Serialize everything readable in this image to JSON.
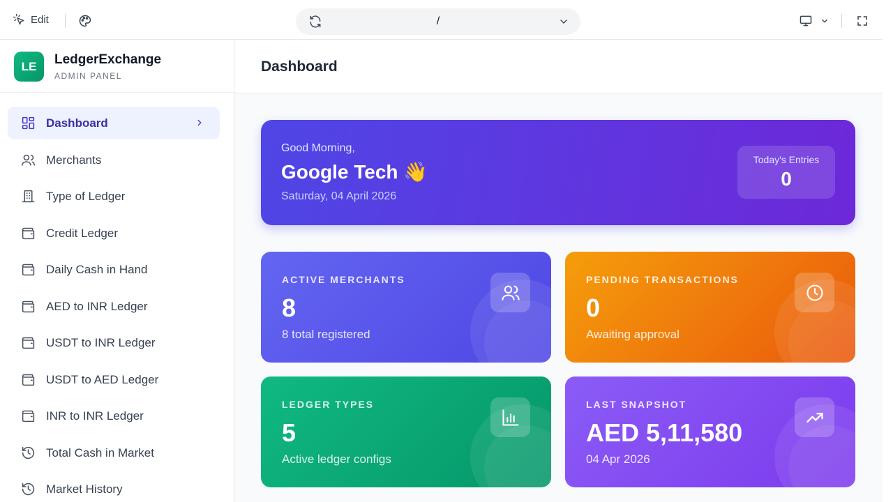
{
  "topbar": {
    "edit_label": "Edit",
    "url_path": "/"
  },
  "brand": {
    "logo_text": "LE",
    "name": "LedgerExchange",
    "subtitle": "ADMIN PANEL"
  },
  "nav": [
    {
      "label": "Dashboard",
      "icon": "grid-icon"
    },
    {
      "label": "Merchants",
      "icon": "users-icon"
    },
    {
      "label": "Type of Ledger",
      "icon": "building-icon"
    },
    {
      "label": "Credit Ledger",
      "icon": "wallet-icon"
    },
    {
      "label": "Daily Cash in Hand",
      "icon": "wallet-icon"
    },
    {
      "label": "AED to INR Ledger",
      "icon": "wallet-icon"
    },
    {
      "label": "USDT to INR Ledger",
      "icon": "wallet-icon"
    },
    {
      "label": "USDT to AED Ledger",
      "icon": "wallet-icon"
    },
    {
      "label": "INR to INR Ledger",
      "icon": "wallet-icon"
    },
    {
      "label": "Total Cash in Market",
      "icon": "history-icon"
    },
    {
      "label": "Market History",
      "icon": "history-icon"
    }
  ],
  "page": {
    "title": "Dashboard"
  },
  "hero": {
    "greeting": "Good Morning,",
    "name": "Google Tech 👋",
    "date": "Saturday, 04 April 2026",
    "entries_label": "Today's Entries",
    "entries_value": "0"
  },
  "cards": {
    "active_merchants": {
      "label": "ACTIVE MERCHANTS",
      "value": "8",
      "sub": "8 total registered",
      "icon": "users-icon",
      "color": "#5b5cf0"
    },
    "pending_transactions": {
      "label": "PENDING TRANSACTIONS",
      "value": "0",
      "sub": "Awaiting approval",
      "icon": "clock-icon",
      "color": "#f59e0b"
    },
    "ledger_types": {
      "label": "LEDGER TYPES",
      "value": "5",
      "sub": "Active ledger configs",
      "icon": "bar-chart-icon",
      "color": "#10b981"
    },
    "last_snapshot": {
      "label": "LAST SNAPSHOT",
      "value": "AED 5,11,580",
      "sub": "04 Apr 2026",
      "icon": "trending-up-icon",
      "color": "#8b5cf6"
    }
  }
}
